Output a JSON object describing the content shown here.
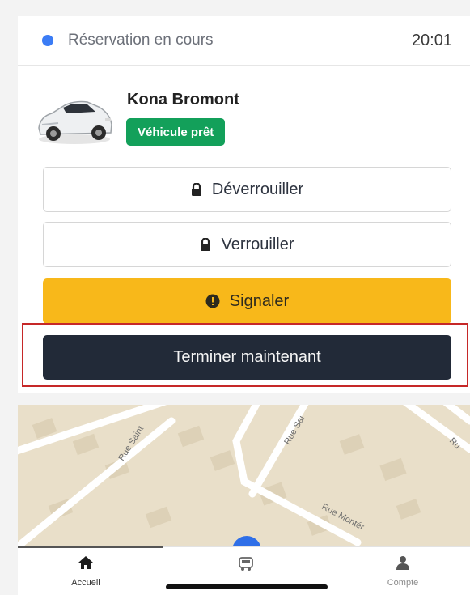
{
  "status": {
    "label": "Réservation en cours",
    "time": "20:01",
    "dot_color": "#3b7cf5"
  },
  "vehicle": {
    "name": "Kona Bromont",
    "badge": "Véhicule prêt",
    "badge_color": "#13a05a",
    "image_icon": "car-photo"
  },
  "actions": {
    "unlock_label": "Déverrouiller",
    "unlock_icon": "lock-icon",
    "lock_label": "Verrouiller",
    "lock_icon": "lock-icon",
    "report_label": "Signaler",
    "report_icon": "alert-circle-icon",
    "report_color": "#f8b81a",
    "finish_label": "Terminer maintenant",
    "finish_color": "#222a38"
  },
  "map": {
    "streets": [
      "Rue Saint",
      "Rue Sai",
      "Ru",
      "Rue Montér"
    ]
  },
  "tabs": [
    {
      "label": "Accueil",
      "icon": "home-icon",
      "active": true
    },
    {
      "label": "",
      "icon": "vehicle-icon",
      "active": false
    },
    {
      "label": "Compte",
      "icon": "user-icon",
      "active": false
    }
  ]
}
